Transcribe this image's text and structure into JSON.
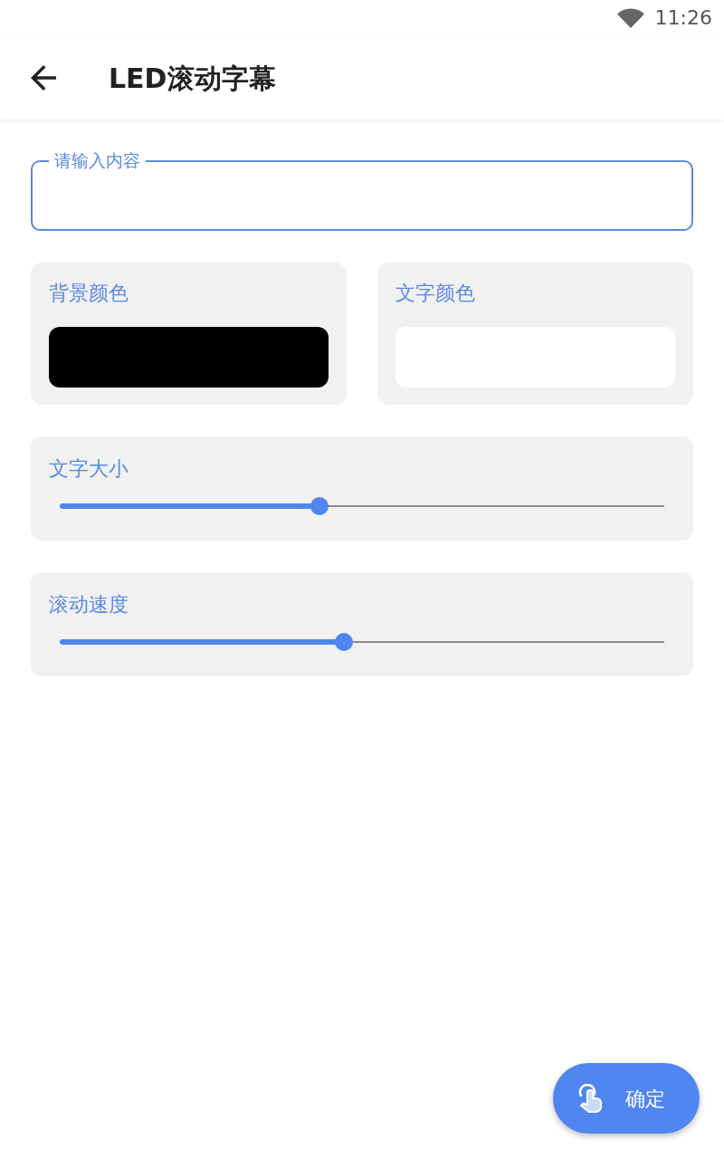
{
  "status_bar": {
    "time": "11:26"
  },
  "app_bar": {
    "title": "LED滚动字幕"
  },
  "content_field": {
    "label": "请输入内容",
    "focused": true
  },
  "color_pickers": [
    {
      "label": "背景颜色",
      "color": "#000000"
    },
    {
      "label": "文字颜色",
      "color": "#ffffff"
    }
  ],
  "sliders": [
    {
      "label": "文字大小",
      "level": 0.43
    },
    {
      "label": "滚动速度",
      "level": 0.47
    }
  ],
  "confirm_button": {
    "label": "确定"
  }
}
